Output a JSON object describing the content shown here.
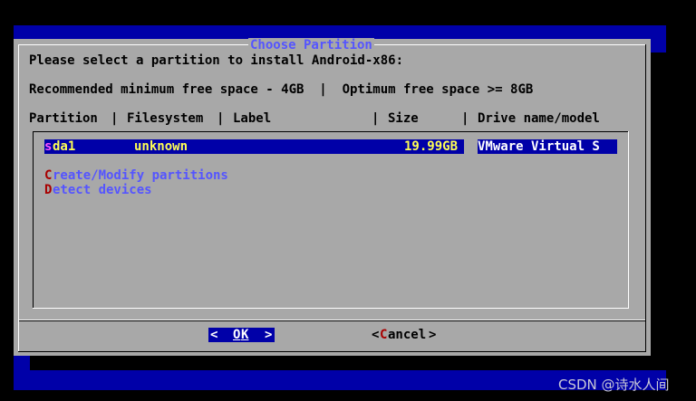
{
  "dialog": {
    "title": "Choose Partition",
    "prompt": "Please select a partition to install Android-x86:",
    "recommendation": "Recommended minimum free space - 4GB  |  Optimum free space >= 8GB",
    "columns": [
      "Partition",
      "Filesystem",
      "Label",
      "Size",
      "Drive name/model"
    ],
    "separator": "|"
  },
  "partitions": [
    {
      "hot": "s",
      "name_rest": "da1",
      "filesystem": "unknown",
      "label": "",
      "size": "19.99GB",
      "drive": "VMware Virtual S"
    }
  ],
  "actions": [
    {
      "hot": "C",
      "rest": "reate/Modify partitions"
    },
    {
      "hot": "D",
      "rest": "etect devices"
    }
  ],
  "buttons": {
    "ok": {
      "left": "<",
      "hot": "O",
      "rest": "K",
      "right": ">"
    },
    "cancel": {
      "left": "<",
      "hot": "C",
      "rest": "ancel",
      "right": ">"
    }
  },
  "watermark": "CSDN @诗水人间",
  "colors": {
    "screen_bg": "#0000a8",
    "dialog_bg": "#a8a8a8",
    "highlight": "#0000a8",
    "hotkey": "#a80000",
    "action_text": "#5555ff",
    "title_text": "#5555ff",
    "selected_text": "#ffff55"
  }
}
